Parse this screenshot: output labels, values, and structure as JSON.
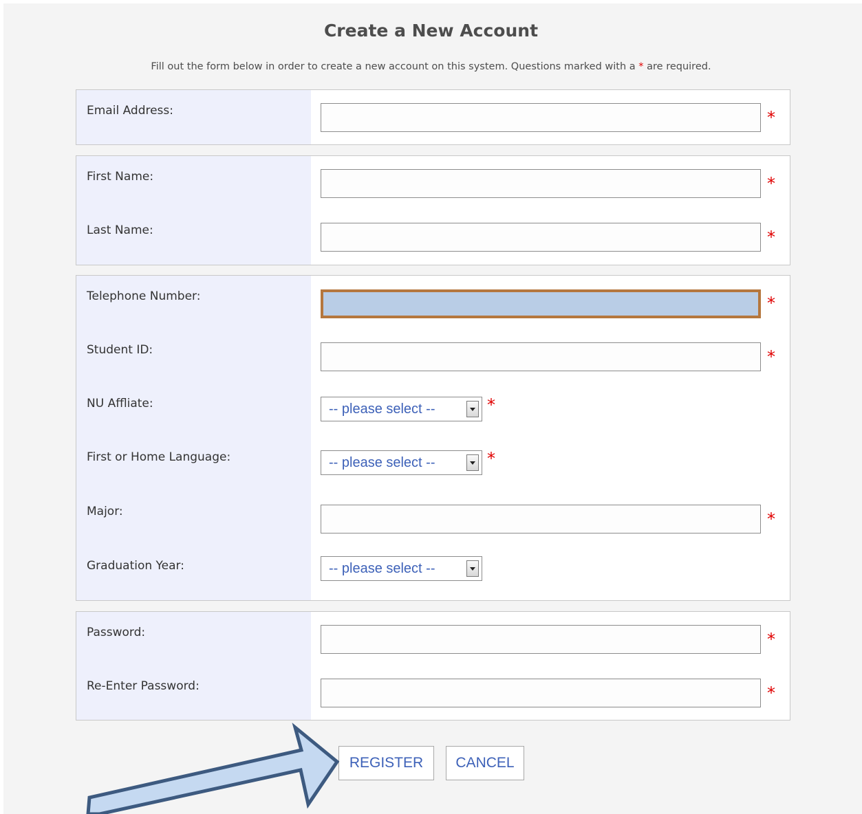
{
  "form": {
    "title": "Create a New Account",
    "intro_before": "Fill out the form below in order to create a new account on this system. Questions marked with a ",
    "intro_star": "*",
    "intro_after": " are required.",
    "required_mark": "*"
  },
  "fields": {
    "email": {
      "label": "Email Address:",
      "value": ""
    },
    "first_name": {
      "label": "First Name:",
      "value": ""
    },
    "last_name": {
      "label": "Last Name:",
      "value": ""
    },
    "telephone": {
      "label": "Telephone Number:",
      "value": "",
      "focused": true
    },
    "student_id": {
      "label": "Student ID:",
      "value": ""
    },
    "nu_affiliate": {
      "label": "NU Affliate:",
      "selected": "-- please select --"
    },
    "home_language": {
      "label": "First or Home Language:",
      "selected": "-- please select --"
    },
    "major": {
      "label": "Major:",
      "value": ""
    },
    "graduation_year": {
      "label": "Graduation Year:",
      "selected": "-- please select --"
    },
    "password": {
      "label": "Password:",
      "value": ""
    },
    "password_confirm": {
      "label": "Re-Enter Password:",
      "value": ""
    }
  },
  "actions": {
    "register_label": "REGISTER",
    "cancel_label": "CANCEL"
  },
  "annotation": {
    "icon": "arrow-icon",
    "points_to": "register-button",
    "fill_color": "#c5d9f1",
    "stroke_color": "#3d5a80"
  },
  "colors": {
    "label_column": "#eef0fc",
    "required": "#e00000",
    "link_blue": "#3d61b8",
    "focus_border": "#b5773e",
    "focus_fill": "#b9cde6"
  }
}
